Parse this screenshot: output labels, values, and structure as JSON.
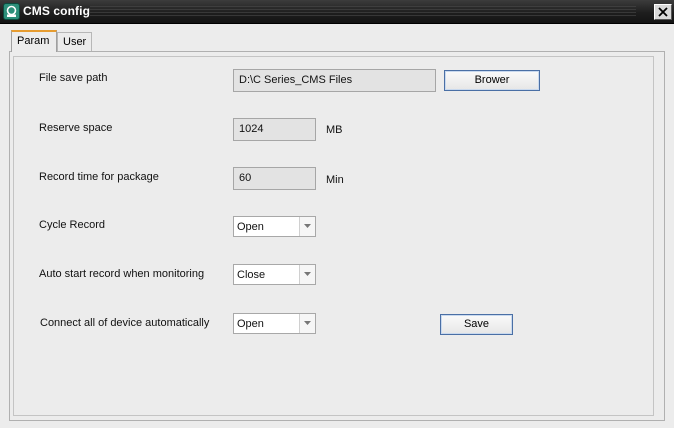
{
  "window": {
    "title": "CMS config"
  },
  "tabs": [
    {
      "label": "Param",
      "active": true
    },
    {
      "label": "User",
      "active": false
    }
  ],
  "param": {
    "file_save_path": {
      "label": "File save path",
      "value": "D:\\C Series_CMS Files",
      "browse_button": "Brower"
    },
    "reserve_space": {
      "label": "Reserve space",
      "value": "1024",
      "unit": "MB"
    },
    "record_time": {
      "label": "Record time for package",
      "value": "60",
      "unit": "Min"
    },
    "cycle_record": {
      "label": "Cycle Record",
      "selected": "Open"
    },
    "auto_start_record": {
      "label": "Auto start record when monitoring",
      "selected": "Close"
    },
    "connect_all": {
      "label": "Connect all of device automatically",
      "selected": "Open"
    },
    "save_button": "Save"
  },
  "icons": {
    "app": "cms-app-icon",
    "close": "close-icon",
    "dropdown": "chevron-down-icon"
  },
  "colors": {
    "titlebar": "#1e1e1e",
    "active_tab_accent": "#e69c30",
    "button_border": "#4a6fa5"
  }
}
